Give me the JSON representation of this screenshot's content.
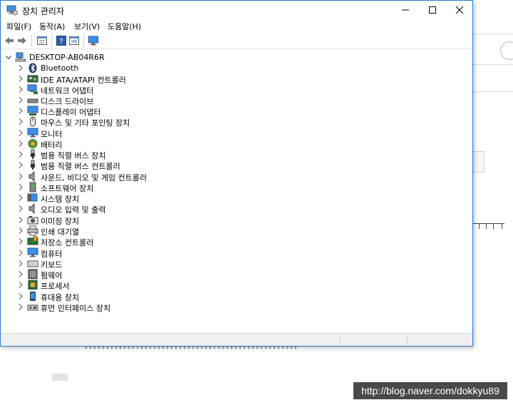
{
  "window": {
    "title": "장치 관리자"
  },
  "menu": [
    {
      "label": "파일(F)"
    },
    {
      "label": "동작(A)"
    },
    {
      "label": "보기(V)"
    },
    {
      "label": "도움말(H)"
    }
  ],
  "toolbar": {
    "icons": [
      "back-icon",
      "forward-icon",
      "properties-icon",
      "help-icon",
      "update-driver-icon",
      "monitor-icon"
    ]
  },
  "tree": {
    "root": {
      "label": "DESKTOP-AB04R6R",
      "icon": "computer-icon"
    },
    "items": [
      {
        "label": "Bluetooth",
        "icon": "bluetooth-icon"
      },
      {
        "label": "IDE ATA/ATAPI 컨트롤러",
        "icon": "ide-controller-icon"
      },
      {
        "label": "네트워크 어댑터",
        "icon": "network-adapter-icon"
      },
      {
        "label": "디스크 드라이브",
        "icon": "disk-drive-icon"
      },
      {
        "label": "디스플레이 어댑터",
        "icon": "display-adapter-icon"
      },
      {
        "label": "마우스 및 기타 포인팅 장치",
        "icon": "mouse-icon"
      },
      {
        "label": "모니터",
        "icon": "monitor-icon"
      },
      {
        "label": "배터리",
        "icon": "battery-icon"
      },
      {
        "label": "범용 직렬 버스 장치",
        "icon": "usb-icon"
      },
      {
        "label": "범용 직렬 버스 컨트롤러",
        "icon": "usb-icon"
      },
      {
        "label": "사운드, 비디오 및 게임 컨트롤러",
        "icon": "speaker-icon"
      },
      {
        "label": "소프트웨어 장치",
        "icon": "software-device-icon"
      },
      {
        "label": "시스템 장치",
        "icon": "system-device-icon"
      },
      {
        "label": "오디오 입력 및 출력",
        "icon": "speaker-icon"
      },
      {
        "label": "이미징 장치",
        "icon": "camera-icon"
      },
      {
        "label": "인쇄 대기열",
        "icon": "printer-icon"
      },
      {
        "label": "저장소 컨트롤러",
        "icon": "storage-controller-icon"
      },
      {
        "label": "컴퓨터",
        "icon": "computer-monitor-icon"
      },
      {
        "label": "키보드",
        "icon": "keyboard-icon"
      },
      {
        "label": "펌웨어",
        "icon": "firmware-icon"
      },
      {
        "label": "프로세서",
        "icon": "processor-icon"
      },
      {
        "label": "휴대용 장치",
        "icon": "portable-device-icon"
      },
      {
        "label": "휴먼 인터페이스 장치",
        "icon": "hid-icon"
      }
    ]
  },
  "watermark": {
    "text": "http://blog.naver.com/dokkyu89"
  },
  "colors": {
    "window_border": "#2b78c6",
    "watermark_bg": "#4a4a4a"
  }
}
